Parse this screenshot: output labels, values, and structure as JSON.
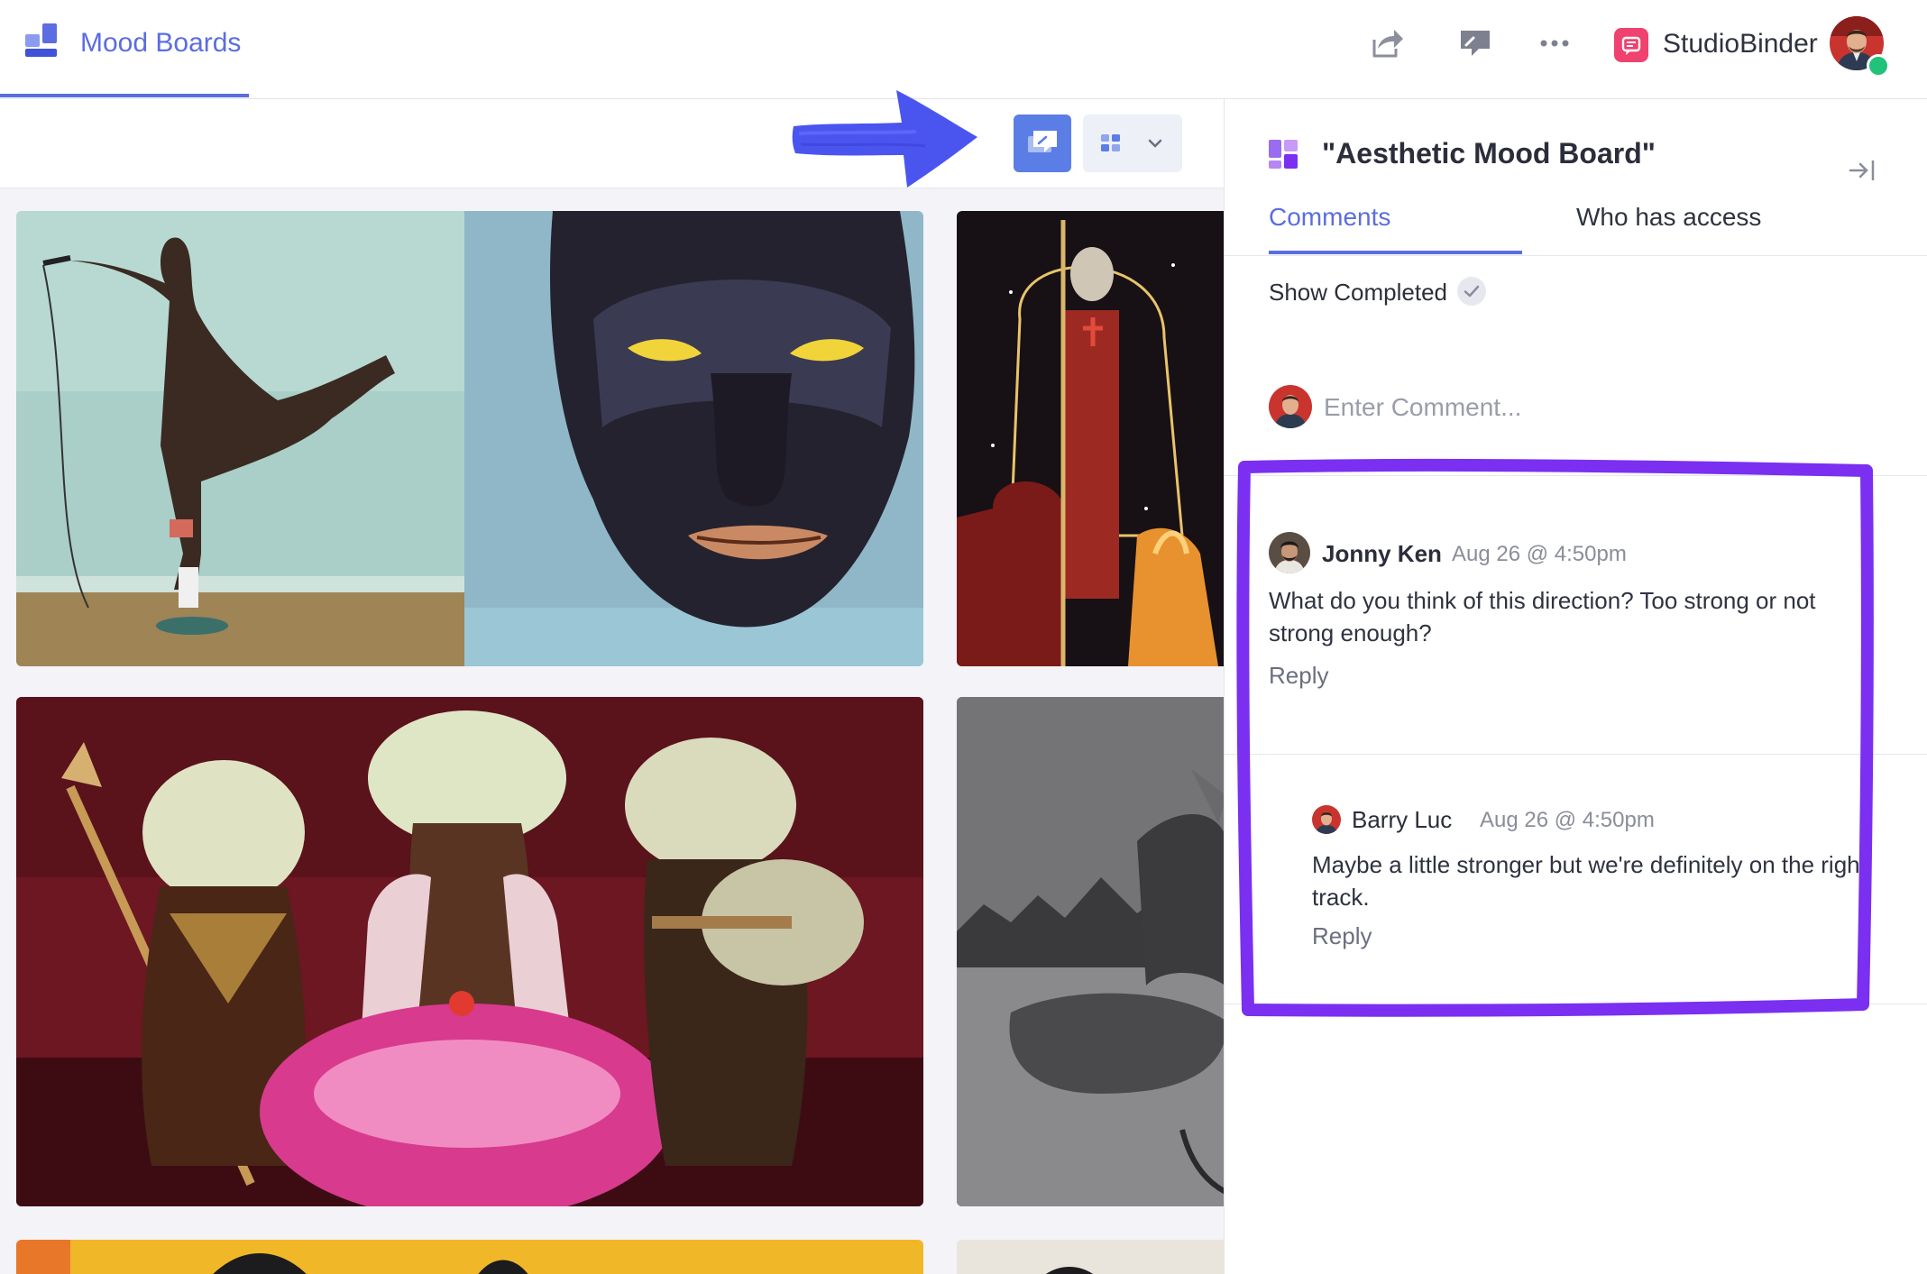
{
  "header": {
    "app_title": "Mood Boards",
    "brand_name": "StudioBinder",
    "icons": [
      "board-logo-icon",
      "share-icon",
      "presentation-icon",
      "more-icon",
      "studiobinder-logo-icon",
      "user-avatar"
    ]
  },
  "toolbar": {
    "icons": [
      "comments-toggle-icon",
      "grid-view-icon",
      "chevron-down-icon"
    ]
  },
  "colors": {
    "accent": "#5b6de0",
    "annotation": "#7b2ff0",
    "arrow": "#4a55f0",
    "toggle_active": "#5b7ee6",
    "online": "#21c27a"
  },
  "panel": {
    "title": "\"Aesthetic Mood Board\"",
    "tabs": [
      {
        "label": "Comments",
        "active": true
      },
      {
        "label": "Who has access",
        "active": false
      }
    ],
    "show_completed_label": "Show Completed",
    "composer_placeholder": "Enter Comment...",
    "comments": [
      {
        "author": "Jonny Ken",
        "time": "Aug 26 @ 4:50pm",
        "text": "What do you think of this direction? Too strong or not strong enough?",
        "reply_label": "Reply"
      },
      {
        "author": "Barry Luc",
        "time": "Aug 26 @ 4:50pm",
        "text": "Maybe a little stronger but we're definitely on the right track.",
        "reply_label": "Reply"
      }
    ]
  }
}
